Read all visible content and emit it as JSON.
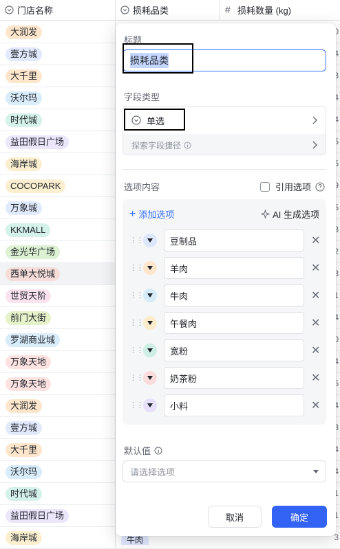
{
  "headers": {
    "store": "门店名称",
    "category": "损耗品类",
    "quantity": "损耗数量 (kg)"
  },
  "store_rows": [
    {
      "name": "大润发",
      "color": "#fde6cc"
    },
    {
      "name": "壹方城",
      "color": "#e1e9fc"
    },
    {
      "name": "大千里",
      "color": "#fde6cc"
    },
    {
      "name": "沃尔玛",
      "color": "#d9ecfa"
    },
    {
      "name": "时代城",
      "color": "#d4f1ea"
    },
    {
      "name": "益田假日广场",
      "color": "#ece6fb"
    },
    {
      "name": "海岸城",
      "color": "#fbefd0"
    },
    {
      "name": "COCOPARK",
      "color": "#fbefd0"
    },
    {
      "name": "万象城",
      "color": "#e1e9fc"
    },
    {
      "name": "KKMALL",
      "color": "#d4f1ea"
    },
    {
      "name": "金光华广场",
      "color": "#ddf2d2"
    },
    {
      "name": "西单大悦城",
      "color": "#f6ddd9"
    },
    {
      "name": "世贸天阶",
      "color": "#fbe2ef"
    },
    {
      "name": "前门大街",
      "color": "#e6f2c9"
    },
    {
      "name": "罗湖商业城",
      "color": "#d9ecfa"
    },
    {
      "name": "万象天地",
      "color": "#fde2e2"
    },
    {
      "name": "万象天地",
      "color": "#fde2e2"
    },
    {
      "name": "大润发",
      "color": "#fde6cc"
    },
    {
      "name": "壹方城",
      "color": "#e1e9fc"
    },
    {
      "name": "大千里",
      "color": "#fde6cc"
    },
    {
      "name": "沃尔玛",
      "color": "#d9ecfa"
    },
    {
      "name": "时代城",
      "color": "#d4f1ea"
    },
    {
      "name": "益田假日广场",
      "color": "#ece6fb"
    },
    {
      "name": "海岸城",
      "color": "#fbefd0"
    }
  ],
  "qty_partial": [
    "0",
    "4",
    "3",
    "4",
    "4",
    "5",
    "5",
    "9",
    "5",
    "3",
    "2",
    "3",
    "1",
    "4",
    "0",
    "4",
    "5",
    "4",
    "3",
    "4",
    "4",
    "1",
    "1",
    "3"
  ],
  "bottom_category": "牛肉",
  "panel": {
    "title_label": "标题",
    "title_value": "损耗品类",
    "field_type_label": "字段类型",
    "field_type_value": "单选",
    "shortcut_label": "探索字段捷径",
    "options_label": "选项内容",
    "ref_label": "引用选项",
    "add_option": "添加选项",
    "ai_option": "AI 生成选项",
    "options": [
      {
        "value": "豆制品",
        "color": "#dce6fc"
      },
      {
        "value": "羊肉",
        "color": "#fde6cc"
      },
      {
        "value": "牛肉",
        "color": "#d5ecf8"
      },
      {
        "value": "午餐肉",
        "color": "#fbeccb"
      },
      {
        "value": "宽粉",
        "color": "#cfeee6"
      },
      {
        "value": "奶茶粉",
        "color": "#fbdcdc"
      },
      {
        "value": "小料",
        "color": "#e6e0fa"
      }
    ],
    "default_label": "默认值",
    "default_placeholder": "请选择选项",
    "cancel": "取消",
    "confirm": "确定"
  }
}
